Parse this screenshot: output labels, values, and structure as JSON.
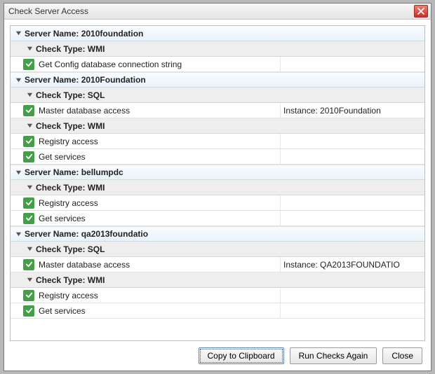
{
  "dialog": {
    "title": "Check Server Access"
  },
  "labels": {
    "server_prefix": "Server Name:",
    "type_prefix": "Check Type:",
    "instance_prefix": "Instance:"
  },
  "buttons": {
    "copy": "Copy to Clipboard",
    "run": "Run Checks Again",
    "close": "Close"
  },
  "servers": [
    {
      "name": "2010foundation",
      "groups": [
        {
          "type": "WMI",
          "checks": [
            {
              "label": "Get Config database connection string",
              "status": "ok",
              "detail": ""
            }
          ]
        }
      ]
    },
    {
      "name": "2010Foundation",
      "groups": [
        {
          "type": "SQL",
          "checks": [
            {
              "label": "Master database access",
              "status": "ok",
              "instance": "2010Foundation"
            }
          ]
        },
        {
          "type": "WMI",
          "checks": [
            {
              "label": "Registry access",
              "status": "ok",
              "detail": ""
            },
            {
              "label": "Get services",
              "status": "ok",
              "detail": ""
            }
          ]
        }
      ]
    },
    {
      "name": "bellumpdc",
      "groups": [
        {
          "type": "WMI",
          "checks": [
            {
              "label": "Registry access",
              "status": "ok",
              "detail": ""
            },
            {
              "label": "Get services",
              "status": "ok",
              "detail": ""
            }
          ]
        }
      ]
    },
    {
      "name": "qa2013foundatio",
      "groups": [
        {
          "type": "SQL",
          "checks": [
            {
              "label": "Master database access",
              "status": "ok",
              "instance": "QA2013FOUNDATIO"
            }
          ]
        },
        {
          "type": "WMI",
          "checks": [
            {
              "label": "Registry access",
              "status": "ok",
              "detail": ""
            },
            {
              "label": "Get services",
              "status": "ok",
              "detail": ""
            }
          ]
        }
      ]
    }
  ],
  "icons": {
    "caret_expanded": "chevron-down",
    "status_ok": "check",
    "close": "x"
  }
}
